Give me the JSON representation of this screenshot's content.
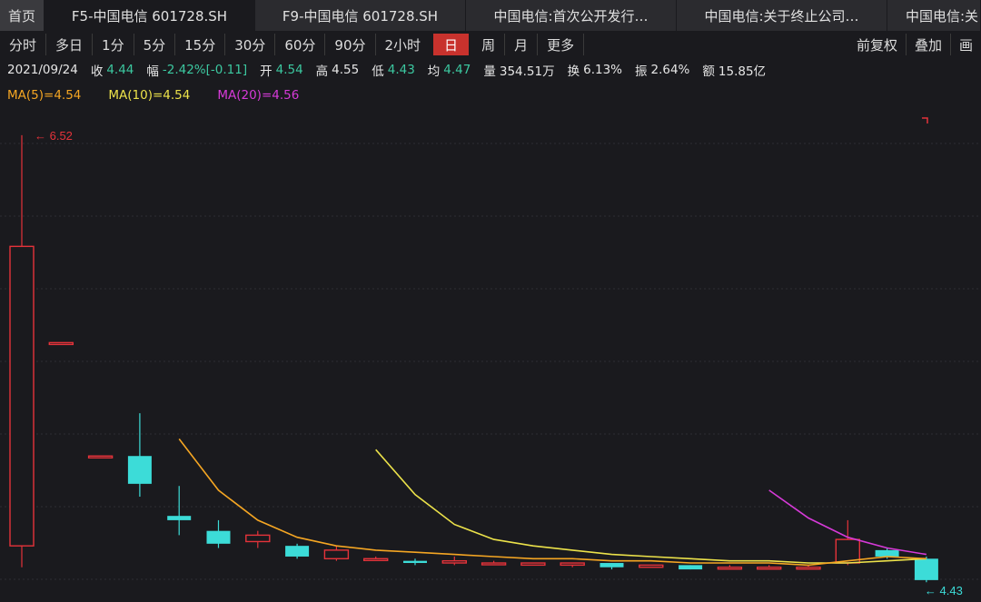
{
  "tabs": [
    "首页",
    "F5-中国电信 601728.SH",
    "F9-中国电信 601728.SH",
    "中国电信:首次公开发行…",
    "中国电信:关于终止公司…",
    "中国电信:关"
  ],
  "periods": [
    "分时",
    "多日",
    "1分",
    "5分",
    "15分",
    "30分",
    "60分",
    "90分",
    "2小时",
    "日",
    "周",
    "月",
    "更多"
  ],
  "active_period": "日",
  "right_buttons": [
    "前复权",
    "叠加",
    "画"
  ],
  "info": {
    "date": "2021/09/24",
    "close_label": "收",
    "close": "4.44",
    "change_label": "幅",
    "change": "-2.42%[-0.11]",
    "open_label": "开",
    "open": "4.54",
    "high_label": "高",
    "high": "4.55",
    "low_label": "低",
    "low": "4.43",
    "avg_label": "均",
    "avg": "4.47",
    "vol_label": "量",
    "vol": "354.51万",
    "turnover_label": "换",
    "turnover": "6.13%",
    "amp_label": "振",
    "amp": "2.64%",
    "amount_label": "额",
    "amount": "15.85亿"
  },
  "ma": {
    "ma5": "MA(5)=4.54",
    "ma10": "MA(10)=4.54",
    "ma20": "MA(20)=4.56"
  },
  "colors": {
    "up": "#e5333a",
    "down": "#3cdcd8",
    "ma5": "#f5a623",
    "ma10": "#ece24a",
    "ma20": "#d63ad8",
    "grid": "#2e2e34"
  },
  "chart_data": {
    "type": "candlestick",
    "max_label": "6.52",
    "min_label": "4.43",
    "ylim": [
      4.38,
      6.6
    ],
    "candles": [
      {
        "o": 4.6,
        "c": 6.0,
        "h": 6.52,
        "l": 4.5
      },
      {
        "o": 5.55,
        "c": 5.55,
        "h": 5.55,
        "l": 5.55
      },
      {
        "o": 5.02,
        "c": 5.02,
        "h": 5.02,
        "l": 5.02
      },
      {
        "o": 5.02,
        "c": 4.89,
        "h": 5.22,
        "l": 4.83
      },
      {
        "o": 4.74,
        "c": 4.72,
        "h": 4.88,
        "l": 4.65
      },
      {
        "o": 4.67,
        "c": 4.61,
        "h": 4.72,
        "l": 4.59
      },
      {
        "o": 4.62,
        "c": 4.65,
        "h": 4.67,
        "l": 4.59
      },
      {
        "o": 4.6,
        "c": 4.55,
        "h": 4.61,
        "l": 4.54
      },
      {
        "o": 4.54,
        "c": 4.58,
        "h": 4.6,
        "l": 4.53
      },
      {
        "o": 4.54,
        "c": 4.54,
        "h": 4.55,
        "l": 4.53
      },
      {
        "o": 4.53,
        "c": 4.52,
        "h": 4.54,
        "l": 4.51
      },
      {
        "o": 4.52,
        "c": 4.53,
        "h": 4.55,
        "l": 4.51
      },
      {
        "o": 4.52,
        "c": 4.52,
        "h": 4.53,
        "l": 4.51
      },
      {
        "o": 4.51,
        "c": 4.52,
        "h": 4.52,
        "l": 4.51
      },
      {
        "o": 4.51,
        "c": 4.52,
        "h": 4.52,
        "l": 4.5
      },
      {
        "o": 4.52,
        "c": 4.5,
        "h": 4.52,
        "l": 4.49
      },
      {
        "o": 4.5,
        "c": 4.51,
        "h": 4.51,
        "l": 4.5
      },
      {
        "o": 4.51,
        "c": 4.49,
        "h": 4.51,
        "l": 4.49
      },
      {
        "o": 4.5,
        "c": 4.5,
        "h": 4.51,
        "l": 4.5
      },
      {
        "o": 4.5,
        "c": 4.5,
        "h": 4.51,
        "l": 4.5
      },
      {
        "o": 4.5,
        "c": 4.5,
        "h": 4.51,
        "l": 4.5
      },
      {
        "o": 4.52,
        "c": 4.63,
        "h": 4.72,
        "l": 4.51
      },
      {
        "o": 4.58,
        "c": 4.55,
        "h": 4.59,
        "l": 4.54
      },
      {
        "o": 4.54,
        "c": 4.44,
        "h": 4.55,
        "l": 4.43
      }
    ],
    "ma5": [
      null,
      null,
      null,
      null,
      5.1,
      4.86,
      4.72,
      4.64,
      4.6,
      4.58,
      4.57,
      4.56,
      4.55,
      4.54,
      4.54,
      4.53,
      4.53,
      4.52,
      4.52,
      4.52,
      4.51,
      4.53,
      4.55,
      4.54
    ],
    "ma10": [
      null,
      null,
      null,
      null,
      null,
      null,
      null,
      null,
      null,
      5.05,
      4.84,
      4.7,
      4.63,
      4.6,
      4.58,
      4.56,
      4.55,
      4.54,
      4.53,
      4.53,
      4.52,
      4.52,
      4.53,
      4.54
    ],
    "ma20": [
      null,
      null,
      null,
      null,
      null,
      null,
      null,
      null,
      null,
      null,
      null,
      null,
      null,
      null,
      null,
      null,
      null,
      null,
      null,
      4.86,
      4.73,
      4.64,
      4.59,
      4.56
    ]
  }
}
